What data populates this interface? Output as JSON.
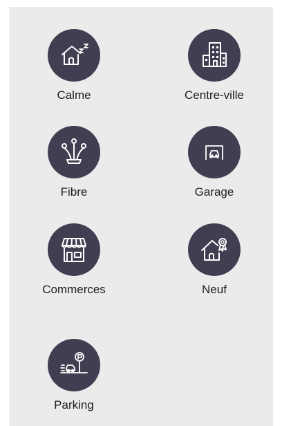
{
  "colors": {
    "background": "#ebebeb",
    "circle": "#403e51",
    "icon": "#ffffff",
    "label": "#1e1e1e"
  },
  "features": [
    {
      "label": "Calme",
      "icon": "house-sleeping-icon"
    },
    {
      "label": "Centre-ville",
      "icon": "city-buildings-icon"
    },
    {
      "label": "Fibre",
      "icon": "fiber-optic-icon"
    },
    {
      "label": "Garage",
      "icon": "garage-icon"
    },
    {
      "label": "Commerces",
      "icon": "shop-storefront-icon"
    },
    {
      "label": "Neuf",
      "icon": "new-house-award-icon"
    },
    {
      "label": "Parking",
      "icon": "parking-icon"
    }
  ]
}
